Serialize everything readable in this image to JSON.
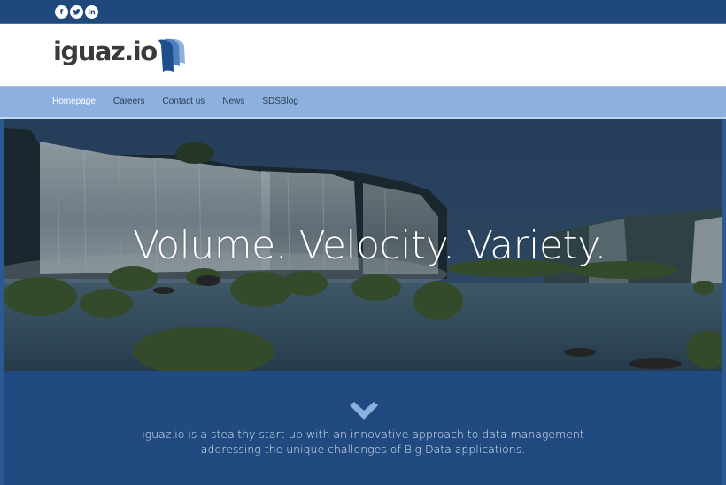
{
  "social": {
    "items": [
      {
        "name": "facebook",
        "icon": "facebook-icon",
        "glyph": "f"
      },
      {
        "name": "twitter",
        "icon": "twitter-icon",
        "glyph": ""
      },
      {
        "name": "linkedin",
        "icon": "linkedin-icon",
        "glyph": "in"
      }
    ]
  },
  "header": {
    "logo_text": "iguaz.io",
    "logo_mark": "iguazio-falls-logo-icon"
  },
  "nav": {
    "items": [
      {
        "label": "Homepage",
        "active": true
      },
      {
        "label": "Careers",
        "active": false
      },
      {
        "label": "Contact us",
        "active": false
      },
      {
        "label": "News",
        "active": false
      },
      {
        "label": "SDSBlog",
        "active": false
      }
    ]
  },
  "hero": {
    "title": "Volume. Velocity. Variety.",
    "image": "waterfall-landscape-photo"
  },
  "intro": {
    "scroll_icon": "chevron-down-icon",
    "line1": "iguaz.io is a stealthy start-up with an innovative approach to data management",
    "line2": "addressing the unique challenges of Big Data applications."
  },
  "colors": {
    "topbar": "#1f497d",
    "nav": "#8db1de",
    "section": "#204a80",
    "chevron": "#8db1de",
    "logo_text": "#3a3a3c"
  }
}
